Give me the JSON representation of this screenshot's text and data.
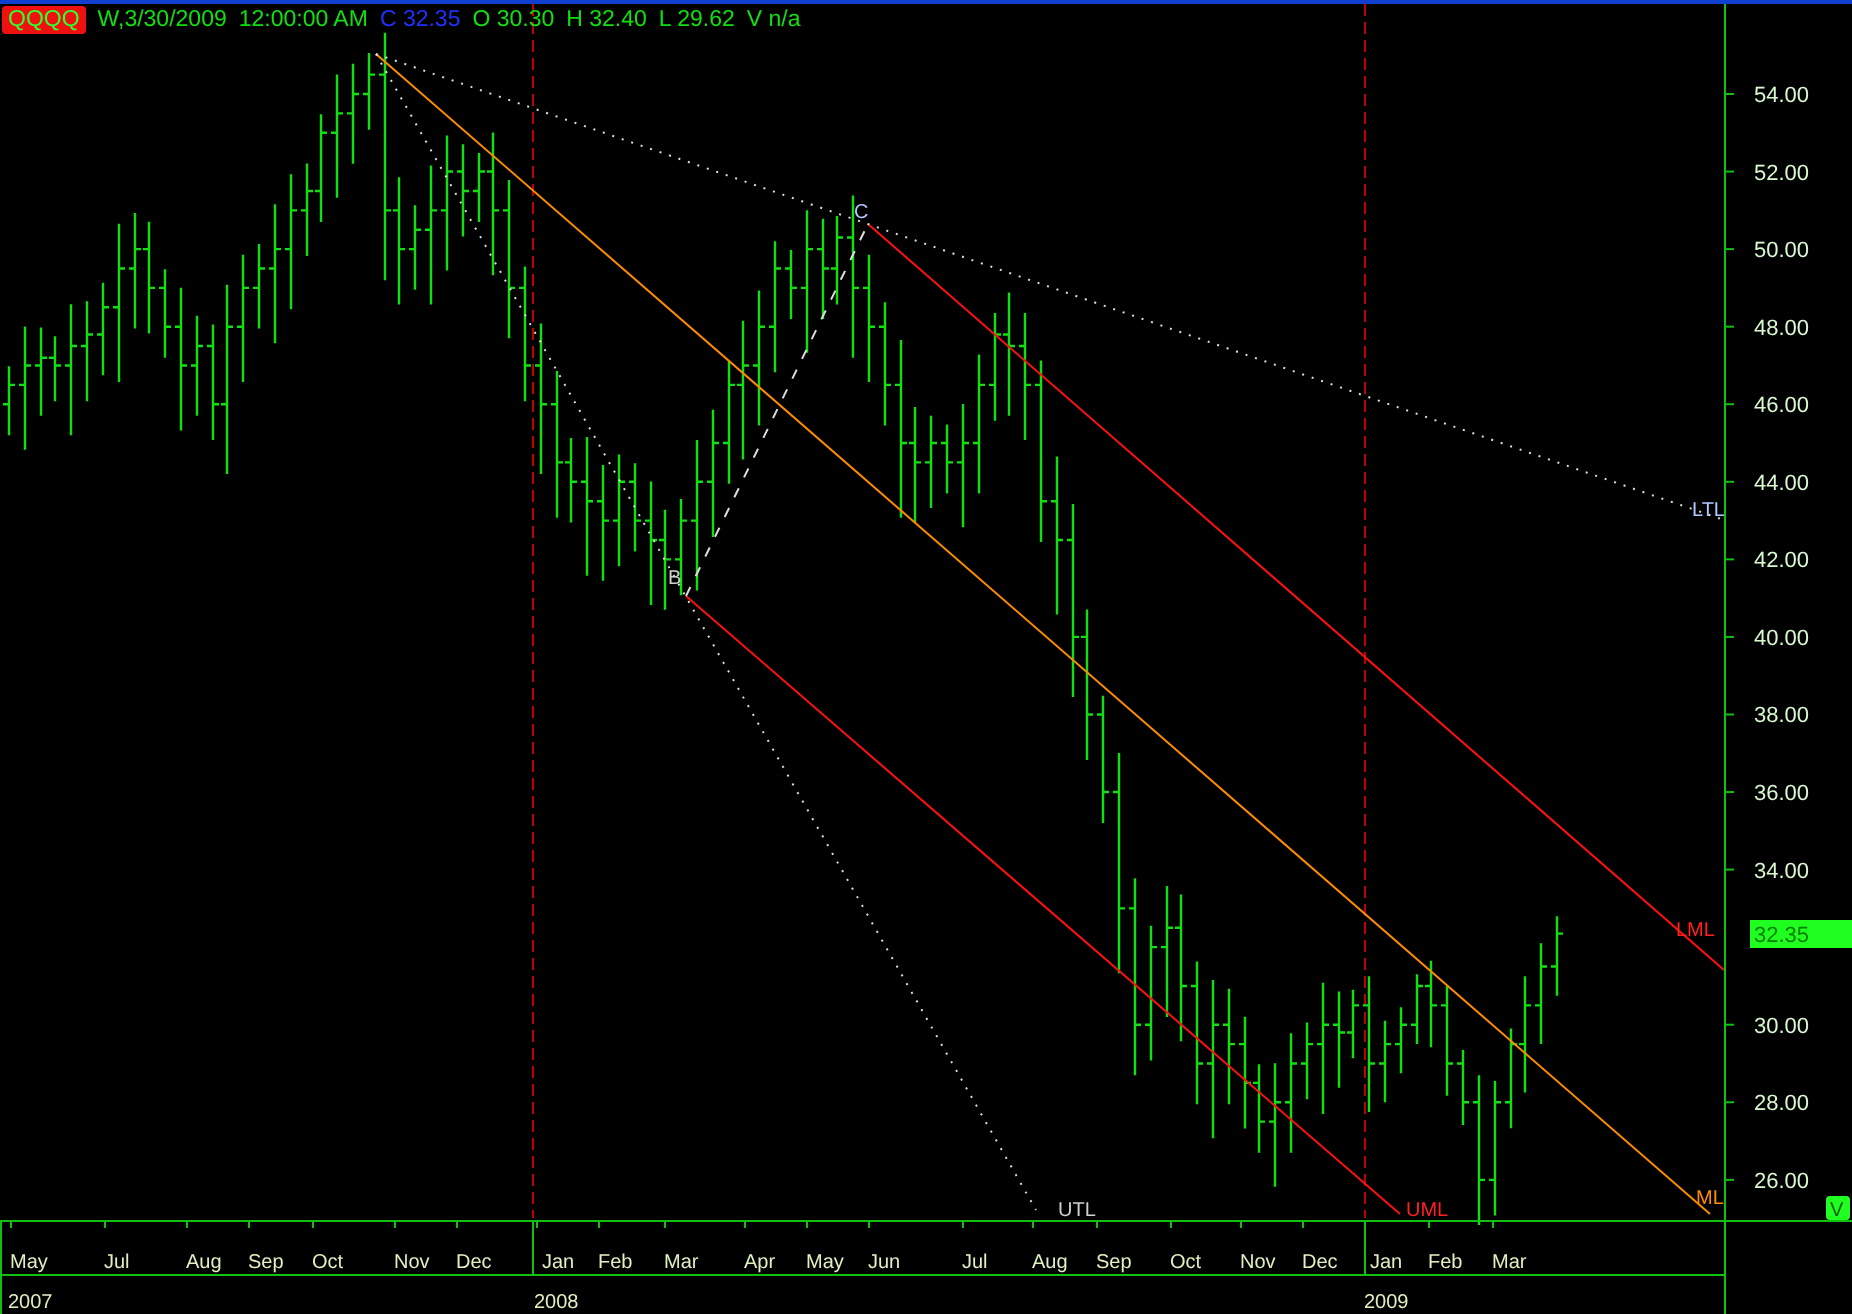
{
  "symbol": "QQQQ",
  "header": {
    "period": "W,3/30/2009",
    "time": "12:00:00 AM",
    "close": "C 32.35",
    "open": "O 30.30",
    "high": "H 32.40",
    "low": "L 29.62",
    "volume": "V n/a"
  },
  "price_axis": [
    "54.00",
    "52.00",
    "50.00",
    "48.00",
    "46.00",
    "44.00",
    "42.00",
    "40.00",
    "38.00",
    "36.00",
    "34.00",
    "30.00",
    "28.00",
    "26.00"
  ],
  "last_price": "32.35",
  "corner_button": "V",
  "pitchfork": {
    "pivot_b": "B",
    "pivot_c": "C",
    "ltl": "LTL",
    "lml": "LML",
    "ml": "ML",
    "utl": "UTL",
    "uml": "UML"
  },
  "months": [
    "May",
    "Jul",
    "Aug",
    "Sep",
    "Oct",
    "Nov",
    "Dec",
    "Jan",
    "Feb",
    "Mar",
    "Apr",
    "May",
    "Jun",
    "Jul",
    "Aug",
    "Sep",
    "Oct",
    "Nov",
    "Dec",
    "Jan",
    "Feb",
    "Mar"
  ],
  "years": [
    "2007",
    "2008",
    "2009"
  ]
}
